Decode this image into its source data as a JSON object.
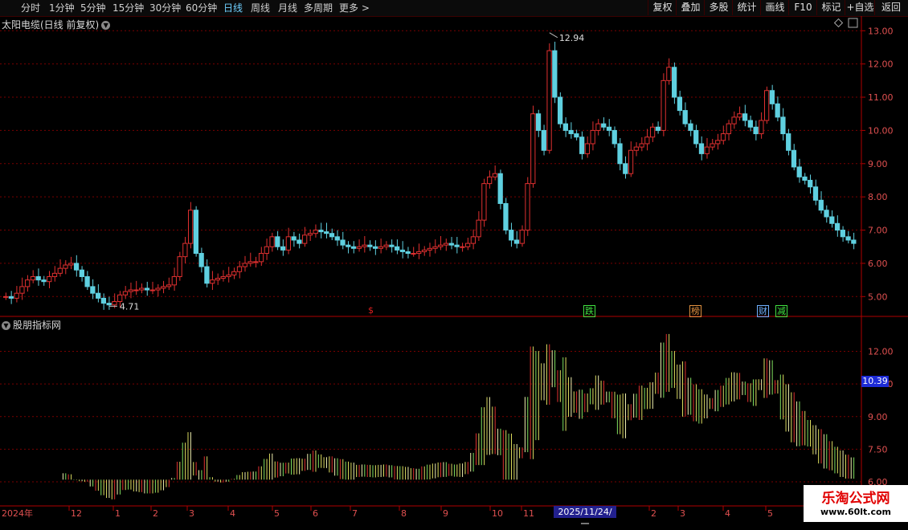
{
  "toolbar": {
    "periods": [
      "分时",
      "1分钟",
      "5分钟",
      "15分钟",
      "30分钟",
      "60分钟",
      "日线",
      "周线",
      "月线",
      "多周期",
      "更多 >"
    ],
    "active_period": "日线",
    "tools": [
      "复权",
      "叠加",
      "多股",
      "统计",
      "画线",
      "F10",
      "标记",
      "+自选",
      "返回"
    ]
  },
  "kline": {
    "title": "太阳电缆(日线 前复权)",
    "y_ticks": [
      "13.00",
      "12.00",
      "11.00",
      "10.00",
      "9.00",
      "8.00",
      "7.00",
      "6.00",
      "5.00"
    ],
    "high_label": "12.94",
    "low_label": "4.71",
    "signals": [
      {
        "text": "$",
        "color": "#e02020"
      },
      {
        "text": "跌",
        "color": "#40e040"
      },
      {
        "text": "榜",
        "color": "#e09040"
      },
      {
        "text": "财",
        "color": "#6fb0ff"
      },
      {
        "text": "减",
        "color": "#40e040"
      }
    ]
  },
  "indicator": {
    "title": "股朋指标网",
    "y_ticks": [
      "12.00",
      "10.50",
      "9.00",
      "7.50",
      "6.00"
    ],
    "current_value": "10.39"
  },
  "xaxis": {
    "year": "2024年",
    "months": [
      "12",
      "1",
      "2",
      "3",
      "4",
      "5",
      "6",
      "7",
      "8",
      "9",
      "10",
      "11",
      "2",
      "3",
      "4",
      "5"
    ],
    "cursor_date": "2025/11/24/一"
  },
  "watermark": {
    "title": "乐淘公式网",
    "url": "www.60lt.com"
  },
  "colors": {
    "up": "#e03030",
    "down": "#5fd0e0",
    "grid": "#7a0000",
    "axis": "#b00000"
  },
  "chart_data": {
    "type": "candlestick",
    "close_series": [
      5.0,
      4.95,
      5.1,
      5.3,
      5.5,
      5.6,
      5.5,
      5.45,
      5.6,
      5.7,
      5.85,
      5.95,
      6.0,
      5.8,
      5.6,
      5.3,
      5.1,
      4.95,
      4.8,
      4.75,
      4.85,
      5.05,
      5.15,
      5.2,
      5.2,
      5.25,
      5.2,
      5.2,
      5.25,
      5.3,
      5.35,
      5.6,
      6.2,
      6.6,
      7.6,
      6.3,
      5.9,
      5.4,
      5.5,
      5.55,
      5.6,
      5.65,
      5.75,
      5.9,
      6.0,
      6.05,
      6.05,
      6.3,
      6.5,
      6.8,
      6.5,
      6.4,
      6.8,
      6.7,
      6.6,
      6.85,
      6.9,
      7.0,
      6.95,
      6.9,
      6.8,
      6.7,
      6.55,
      6.5,
      6.45,
      6.5,
      6.55,
      6.5,
      6.45,
      6.5,
      6.55,
      6.5,
      6.4,
      6.35,
      6.3,
      6.3,
      6.35,
      6.4,
      6.45,
      6.5,
      6.55,
      6.6,
      6.55,
      6.5,
      6.5,
      6.6,
      6.8,
      7.3,
      8.4,
      8.6,
      8.7,
      7.8,
      7.0,
      6.7,
      6.6,
      7.0,
      8.4,
      10.5,
      10.0,
      9.4,
      12.4,
      11.0,
      10.2,
      10.0,
      9.9,
      9.8,
      9.3,
      9.6,
      10.0,
      10.2,
      10.1,
      10.0,
      9.6,
      9.0,
      8.7,
      9.4,
      9.5,
      9.6,
      9.8,
      10.1,
      10.0,
      11.5,
      11.9,
      11.0,
      10.6,
      10.2,
      10.0,
      9.6,
      9.3,
      9.5,
      9.6,
      9.7,
      9.9,
      10.2,
      10.4,
      10.5,
      10.3,
      10.1,
      9.9,
      10.3,
      11.2,
      10.8,
      10.4,
      9.9,
      9.4,
      8.9,
      8.6,
      8.5,
      8.3,
      7.9,
      7.6,
      7.4,
      7.2,
      7.0,
      6.8,
      6.7,
      6.6
    ],
    "ylim_price": [
      4.5,
      13.2
    ],
    "high": 12.94,
    "low": 4.71,
    "indicator_ylim": [
      6.0,
      13.2
    ]
  }
}
